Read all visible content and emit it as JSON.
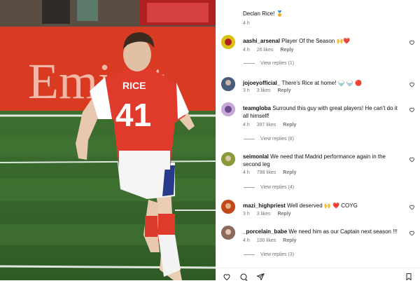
{
  "media": {
    "player_name": "RICE",
    "player_number": "41",
    "banner_text": "Emirat"
  },
  "comments": [
    {
      "user": "",
      "text": "Declan Rice! 🏅",
      "time": "4 h",
      "likes": "",
      "reply": "",
      "view_replies": "",
      "avatar_color": "#ffffff"
    },
    {
      "user": "aashi_arsenal",
      "text": "Player Of the Season 🙌❤️",
      "time": "4 h",
      "likes": "26 likes",
      "reply": "Reply",
      "view_replies": "View replies (1)",
      "avatar_color": "#d9c214"
    },
    {
      "user": "jojoeyofficial_",
      "text": "There's Rice at home! 🍚 🍚 🔴",
      "time": "3 h",
      "likes": "3 likes",
      "reply": "Reply",
      "view_replies": "",
      "avatar_color": "#4a5a7a"
    },
    {
      "user": "teamgloba",
      "text": "Surround this guy with great players! He can't do it all himself!",
      "time": "4 h",
      "likes": "397 likes",
      "reply": "Reply",
      "view_replies": "View replies (8)",
      "avatar_color": "#c9a8d6"
    },
    {
      "user": "seimonlal",
      "text": "We need that Madrid performance again in the second leg",
      "time": "4 h",
      "likes": "798 likes",
      "reply": "Reply",
      "view_replies": "View replies (4)",
      "avatar_color": "#8a9a3a"
    },
    {
      "user": "mazi_highpriest",
      "text": "Well deserved 🙌 ❤️ COYG",
      "time": "3 h",
      "likes": "3 likes",
      "reply": "Reply",
      "view_replies": "",
      "avatar_color": "#c24a1a"
    },
    {
      "user": "_porcelain_babe",
      "text": "We need him as our Captain next season !!!",
      "time": "4 h",
      "likes": "100 likes",
      "reply": "Reply",
      "view_replies": "View replies (3)",
      "avatar_color": "#8a6a5a"
    }
  ],
  "icons": {
    "like": "heart-icon",
    "comment": "comment-icon",
    "share": "send-icon",
    "save": "bookmark-icon"
  },
  "colors": {
    "jersey_red": "#e03a2c",
    "pitch_green": "#3c6a2e",
    "meta_gray": "#737373",
    "heart_red": "#ed1c24"
  }
}
